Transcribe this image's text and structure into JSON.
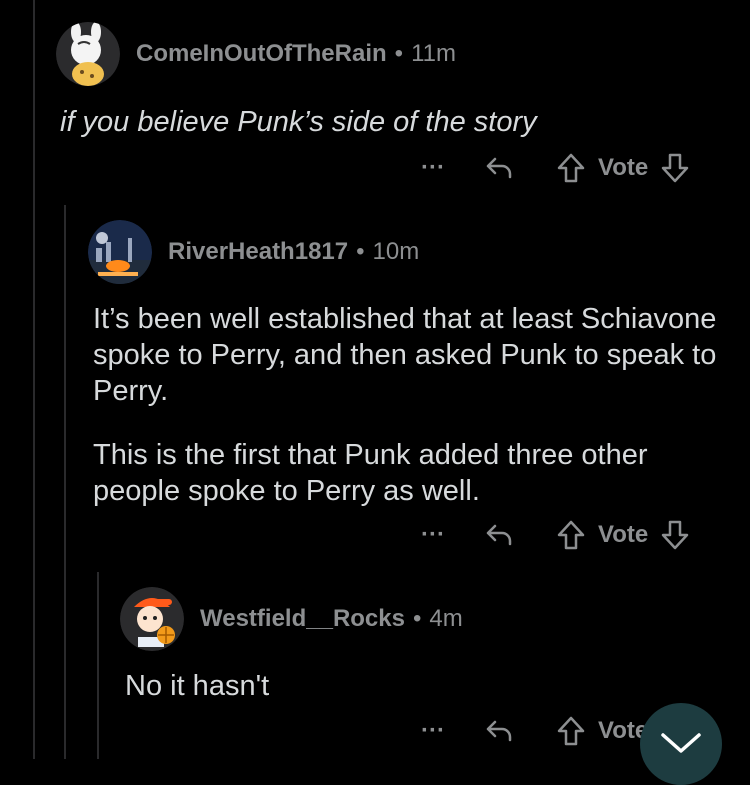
{
  "comments": [
    {
      "username": "ComeInOutOfTheRain",
      "separator": "•",
      "time": "11m",
      "paragraphs": [
        "if you believe Punk’s side of the story"
      ],
      "vote_label": "Vote",
      "more_label": "···"
    },
    {
      "username": "RiverHeath1817",
      "separator": "•",
      "time": "10m",
      "paragraphs": [
        "It’s been well established that at least Schiavone spoke to Perry, and then asked Punk to speak to Perry.",
        "This is the first that Punk added three other people spoke to Perry as well."
      ],
      "vote_label": "Vote",
      "more_label": "···"
    },
    {
      "username": "Westfield__Rocks",
      "separator": "•",
      "time": "4m",
      "paragraphs": [
        "No it hasn't"
      ],
      "vote_label": "Vote",
      "more_label": "···"
    }
  ],
  "colors": {
    "background": "#000000",
    "text": "#d7dadc",
    "muted": "#8d8f91",
    "thread_line": "#2a2a2c",
    "fab": "#1d3c40"
  },
  "icons": [
    "more-icon",
    "reply-icon",
    "upvote-icon",
    "downvote-icon",
    "chevron-down-icon"
  ]
}
